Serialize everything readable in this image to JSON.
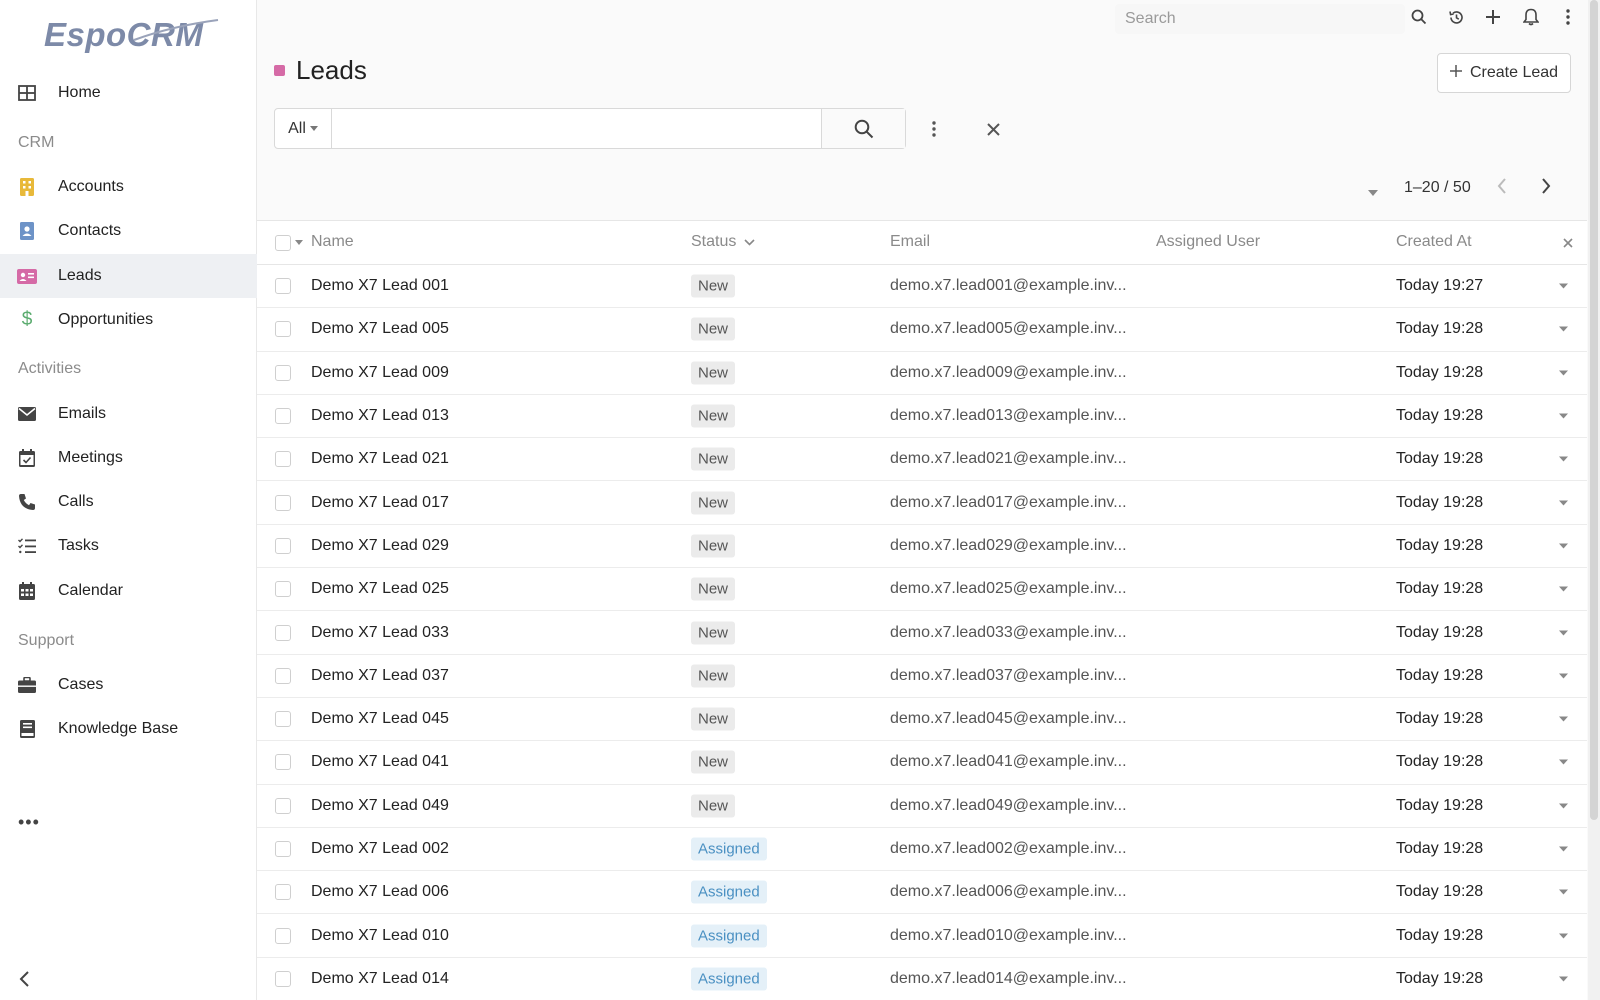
{
  "app": {
    "logo_text": "EspoCRM"
  },
  "sidebar": {
    "home": "Home",
    "groups": {
      "crm": "CRM",
      "activities": "Activities",
      "support": "Support"
    },
    "items": {
      "accounts": "Accounts",
      "contacts": "Contacts",
      "leads": "Leads",
      "opportunities": "Opportunities",
      "emails": "Emails",
      "meetings": "Meetings",
      "calls": "Calls",
      "tasks": "Tasks",
      "calendar": "Calendar",
      "cases": "Cases",
      "knowledge_base": "Knowledge Base"
    },
    "more": "•••",
    "active": "Leads"
  },
  "topbar": {
    "search_placeholder": "Search"
  },
  "header": {
    "title": "Leads",
    "create_label": "Create Lead",
    "title_color": "#d56aa6"
  },
  "filter": {
    "scope": "All",
    "query": ""
  },
  "pagination": {
    "text": "1–20 / 50"
  },
  "table": {
    "columns": {
      "name": "Name",
      "status": "Status",
      "email": "Email",
      "assigned_user": "Assigned User",
      "created_at": "Created At"
    },
    "rows": [
      {
        "name": "Demo X7 Lead 001",
        "status": "New",
        "email": "demo.x7.lead001@example.inv...",
        "assigned_user": "",
        "created_at": "Today 19:27"
      },
      {
        "name": "Demo X7 Lead 005",
        "status": "New",
        "email": "demo.x7.lead005@example.inv...",
        "assigned_user": "",
        "created_at": "Today 19:28"
      },
      {
        "name": "Demo X7 Lead 009",
        "status": "New",
        "email": "demo.x7.lead009@example.inv...",
        "assigned_user": "",
        "created_at": "Today 19:28"
      },
      {
        "name": "Demo X7 Lead 013",
        "status": "New",
        "email": "demo.x7.lead013@example.inv...",
        "assigned_user": "",
        "created_at": "Today 19:28"
      },
      {
        "name": "Demo X7 Lead 021",
        "status": "New",
        "email": "demo.x7.lead021@example.inv...",
        "assigned_user": "",
        "created_at": "Today 19:28"
      },
      {
        "name": "Demo X7 Lead 017",
        "status": "New",
        "email": "demo.x7.lead017@example.inv...",
        "assigned_user": "",
        "created_at": "Today 19:28"
      },
      {
        "name": "Demo X7 Lead 029",
        "status": "New",
        "email": "demo.x7.lead029@example.inv...",
        "assigned_user": "",
        "created_at": "Today 19:28"
      },
      {
        "name": "Demo X7 Lead 025",
        "status": "New",
        "email": "demo.x7.lead025@example.inv...",
        "assigned_user": "",
        "created_at": "Today 19:28"
      },
      {
        "name": "Demo X7 Lead 033",
        "status": "New",
        "email": "demo.x7.lead033@example.inv...",
        "assigned_user": "",
        "created_at": "Today 19:28"
      },
      {
        "name": "Demo X7 Lead 037",
        "status": "New",
        "email": "demo.x7.lead037@example.inv...",
        "assigned_user": "",
        "created_at": "Today 19:28"
      },
      {
        "name": "Demo X7 Lead 045",
        "status": "New",
        "email": "demo.x7.lead045@example.inv...",
        "assigned_user": "",
        "created_at": "Today 19:28"
      },
      {
        "name": "Demo X7 Lead 041",
        "status": "New",
        "email": "demo.x7.lead041@example.inv...",
        "assigned_user": "",
        "created_at": "Today 19:28"
      },
      {
        "name": "Demo X7 Lead 049",
        "status": "New",
        "email": "demo.x7.lead049@example.inv...",
        "assigned_user": "",
        "created_at": "Today 19:28"
      },
      {
        "name": "Demo X7 Lead 002",
        "status": "Assigned",
        "email": "demo.x7.lead002@example.inv...",
        "assigned_user": "",
        "created_at": "Today 19:28"
      },
      {
        "name": "Demo X7 Lead 006",
        "status": "Assigned",
        "email": "demo.x7.lead006@example.inv...",
        "assigned_user": "",
        "created_at": "Today 19:28"
      },
      {
        "name": "Demo X7 Lead 010",
        "status": "Assigned",
        "email": "demo.x7.lead010@example.inv...",
        "assigned_user": "",
        "created_at": "Today 19:28"
      },
      {
        "name": "Demo X7 Lead 014",
        "status": "Assigned",
        "email": "demo.x7.lead014@example.inv...",
        "assigned_user": "",
        "created_at": "Today 19:28"
      }
    ]
  },
  "icons": {
    "home": "grid-icon",
    "accounts": "building-icon",
    "contacts": "contact-card-icon",
    "leads": "id-card-icon",
    "opportunities": "dollar-icon",
    "emails": "envelope-icon",
    "meetings": "calendar-check-icon",
    "calls": "phone-icon",
    "tasks": "checklist-icon",
    "calendar": "calendar-icon",
    "cases": "briefcase-icon",
    "knowledge_base": "book-icon"
  },
  "colors": {
    "accounts": "#e8b93a",
    "contacts": "#6d93c7",
    "leads": "#d56aa6",
    "opportunities": "#5aab6e",
    "assigned": "#4a90c2"
  }
}
